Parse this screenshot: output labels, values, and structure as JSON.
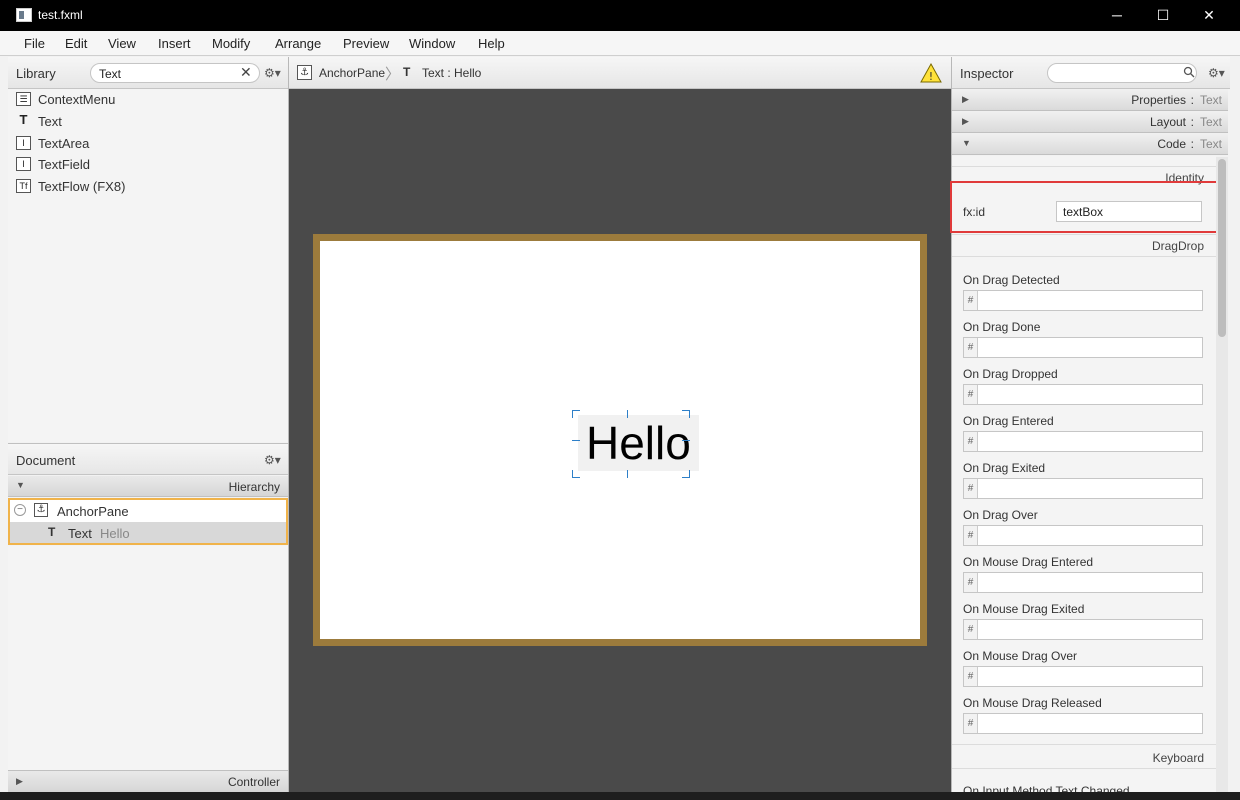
{
  "window": {
    "title": "test.fxml",
    "controls": {
      "minimize": "─",
      "maximize": "☐",
      "close": "✕"
    }
  },
  "menubar": [
    "File",
    "Edit",
    "View",
    "Insert",
    "Modify",
    "Arrange",
    "Preview",
    "Window",
    "Help"
  ],
  "library": {
    "title": "Library",
    "search_value": "Text",
    "items": [
      {
        "label": "ContextMenu",
        "icon": "context-menu-icon",
        "glyph": "☰"
      },
      {
        "label": "Text",
        "icon": "text-icon",
        "glyph": "T"
      },
      {
        "label": "TextArea",
        "icon": "text-area-icon",
        "glyph": "I"
      },
      {
        "label": "TextField",
        "icon": "text-field-icon",
        "glyph": "I"
      },
      {
        "label": "TextFlow  (FX8)",
        "icon": "text-flow-icon",
        "glyph": "Tf"
      }
    ]
  },
  "document": {
    "title": "Document",
    "hierarchy_label": "Hierarchy",
    "tree": [
      {
        "label": "AnchorPane",
        "secondary": ""
      },
      {
        "label": "Text",
        "secondary": "Hello"
      }
    ],
    "controller_label": "Controller"
  },
  "breadcrumb": {
    "items": [
      "AnchorPane",
      "Text : Hello"
    ],
    "warning_glyph": "!"
  },
  "canvas": {
    "text": "Hello"
  },
  "inspector": {
    "title": "Inspector",
    "search_placeholder": "",
    "sections": [
      {
        "name": "Properties",
        "suffix": "Text"
      },
      {
        "name": "Layout",
        "suffix": "Text"
      },
      {
        "name": "Code",
        "suffix": "Text"
      }
    ],
    "identity_label": "Identity",
    "fxid_label": "fx:id",
    "fxid_value": "textBox",
    "dragdrop_label": "DragDrop",
    "events": [
      "On Drag Detected",
      "On Drag Done",
      "On Drag Dropped",
      "On Drag Entered",
      "On Drag Exited",
      "On Drag Over",
      "On Mouse Drag Entered",
      "On Mouse Drag Exited",
      "On Mouse Drag Over",
      "On Mouse Drag Released"
    ],
    "keyboard_label": "Keyboard",
    "next_label": "On Input Method Text Changed"
  },
  "colors": {
    "highlight": "#e03a3a",
    "selection": "#f0b34a",
    "frame": "#9c7b3c",
    "canvas_bg": "#4a4a4a"
  }
}
